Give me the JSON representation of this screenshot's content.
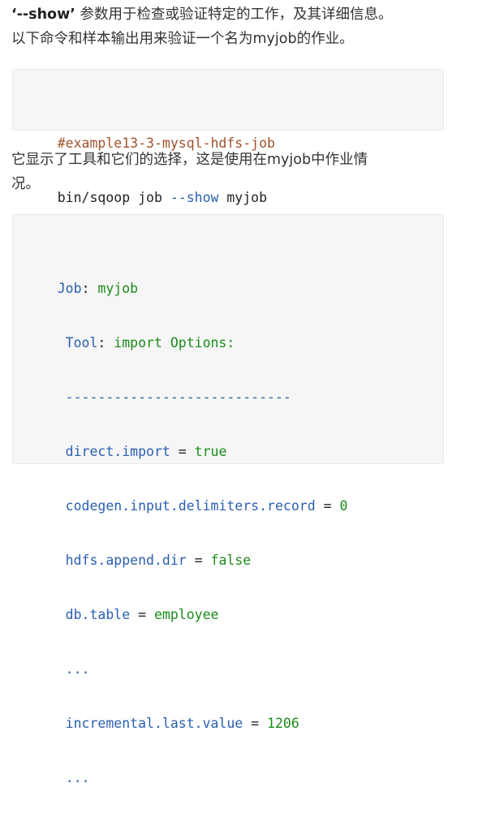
{
  "para1": {
    "line1_bold": "‘--show’",
    "line1_rest": " 参数用于检查或验证特定的工作，及其详细信息。",
    "line2": "以下命令和样本输出用来验证一个名为myjob的作业。"
  },
  "code1": {
    "comment": "#example13-3-mysql-hdfs-job",
    "cmd_prefix": "bin/sqoop job ",
    "cmd_flag": "--show",
    "cmd_arg": " myjob"
  },
  "para2": {
    "line1": "它显示了工具和它们的选择，这是使用在myjob中作业情",
    "line2": "况。"
  },
  "code2": {
    "job_key": "Job",
    "job_sep": ": ",
    "job_val": "myjob",
    "tool_key": " Tool",
    "tool_sep": ": ",
    "tool_val": "import Options:",
    "divider": " ----------------------------",
    "rows": [
      {
        "key": " direct.import",
        "op": " = ",
        "val": "true"
      },
      {
        "key": " codegen.input.delimiters.record",
        "op": " = ",
        "val": "0"
      },
      {
        "key": " hdfs.append.dir",
        "op": " = ",
        "val": "false"
      },
      {
        "key": " db.table",
        "op": " = ",
        "val": "employee"
      }
    ],
    "ellipsis1": " ...",
    "last_key": " incremental.last.value",
    "last_op": " = ",
    "last_val": "1206",
    "ellipsis2": " ..."
  }
}
